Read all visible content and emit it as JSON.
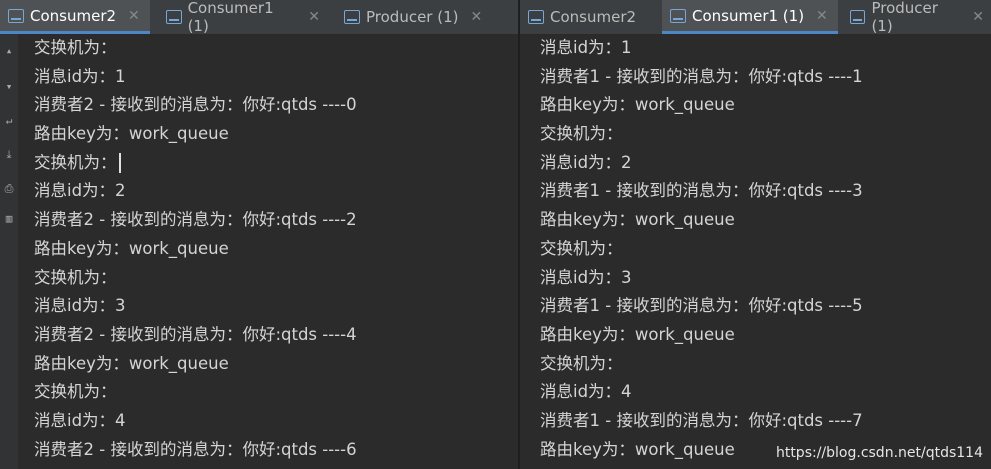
{
  "left": {
    "tabs": [
      {
        "label": "Consumer2",
        "active": true
      },
      {
        "label": "Consumer1 (1)",
        "active": false
      },
      {
        "label": "Producer (1)",
        "active": false
      }
    ],
    "lines": [
      "交换机为：",
      "消息id为：1",
      "消费者2 - 接收到的消息为：你好:qtds ----0",
      "路由key为：work_queue",
      "交换机为：",
      "消息id为：2",
      "消费者2 - 接收到的消息为：你好:qtds ----2",
      "路由key为：work_queue",
      "交换机为：",
      "消息id为：3",
      "消费者2 - 接收到的消息为：你好:qtds ----4",
      "路由key为：work_queue",
      "交换机为：",
      "消息id为：4",
      "消费者2 - 接收到的消息为：你好:qtds ----6"
    ]
  },
  "right": {
    "tabs": [
      {
        "label": "Consumer2",
        "active": false
      },
      {
        "label": "Consumer1 (1)",
        "active": true
      },
      {
        "label": "Producer (1)",
        "active": false
      }
    ],
    "lines": [
      "消息id为：1",
      "消费者1 - 接收到的消息为：你好:qtds ----1",
      "路由key为：work_queue",
      "交换机为：",
      "消息id为：2",
      "消费者1 - 接收到的消息为：你好:qtds ----3",
      "路由key为：work_queue",
      "交换机为：",
      "消息id为：3",
      "消费者1 - 接收到的消息为：你好:qtds ----5",
      "路由key为：work_queue",
      "交换机为：",
      "消息id为：4",
      "消费者1 - 接收到的消息为：你好:qtds ----7",
      "路由key为：work_queue"
    ]
  },
  "watermark": "https://blog.csdn.net/qtds114",
  "gutter_icons": [
    "arrow-up-icon",
    "arrow-down-icon",
    "wrap-icon",
    "scroll-end-icon",
    "print-icon",
    "trash-icon"
  ]
}
